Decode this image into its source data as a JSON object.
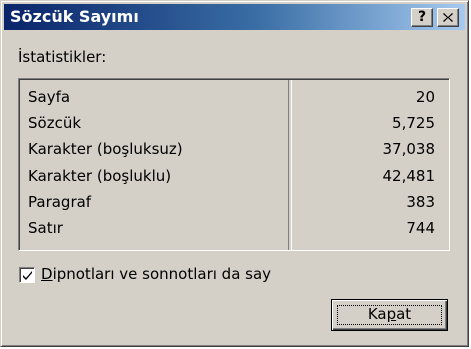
{
  "window": {
    "title": "Sözcük Sayımı",
    "help_button": "?",
    "close_button": "×"
  },
  "stats": {
    "label": "İstatistikler:",
    "rows": [
      {
        "label": "Sayfa",
        "value": "20"
      },
      {
        "label": "Sözcük",
        "value": "5,725"
      },
      {
        "label": "Karakter (boşluksuz)",
        "value": "37,038"
      },
      {
        "label": "Karakter (boşluklu)",
        "value": "42,481"
      },
      {
        "label": "Paragraf",
        "value": "383"
      },
      {
        "label": "Satır",
        "value": "744"
      }
    ]
  },
  "footnotes": {
    "mnemonic": "D",
    "label_rest": "ipnotları ve sonnotları da say",
    "checked": true
  },
  "close_action": {
    "prefix": "Ka",
    "mnemonic": "p",
    "suffix": "at"
  },
  "colors": {
    "title_start": "#0a246a",
    "title_end": "#a6caf0",
    "face": "#d4d0c8"
  }
}
